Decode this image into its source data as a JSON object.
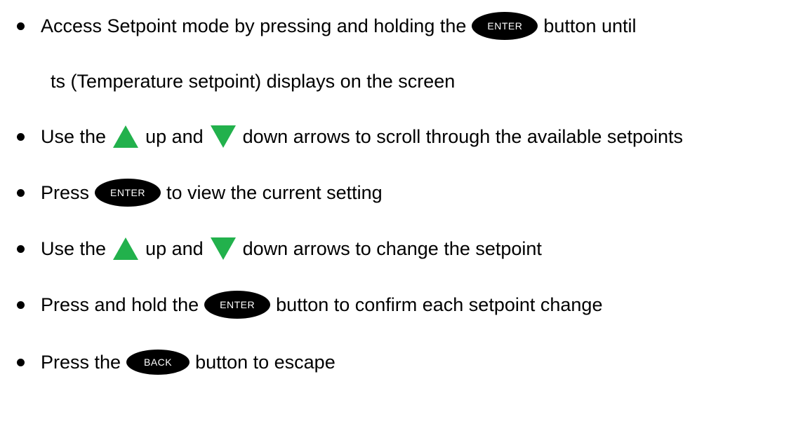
{
  "colors": {
    "text": "#000000",
    "button_fill": "#000000",
    "button_text": "#ffffff",
    "arrow_green": "#22b14c"
  },
  "icons": {
    "up": "green-up-triangle-icon",
    "down": "green-down-triangle-icon"
  },
  "buttons": {
    "enter": "ENTER",
    "back": "BACK"
  },
  "steps": [
    {
      "before": "Access Setpoint mode by pressing and holding the",
      "after": "button until",
      "continuation": "ts (Temperature setpoint) displays on the screen"
    },
    {
      "before": "Use the",
      "middle": "up and",
      "after": "down arrows to scroll through the available setpoints"
    },
    {
      "before": "Press",
      "after": "to view the current setting"
    },
    {
      "before": "Use the",
      "middle": "up and",
      "after": "down arrows to change the setpoint"
    },
    {
      "before": "Press and hold the",
      "after": "button to confirm each setpoint change"
    },
    {
      "before": "Press the",
      "after": "button to escape"
    }
  ]
}
